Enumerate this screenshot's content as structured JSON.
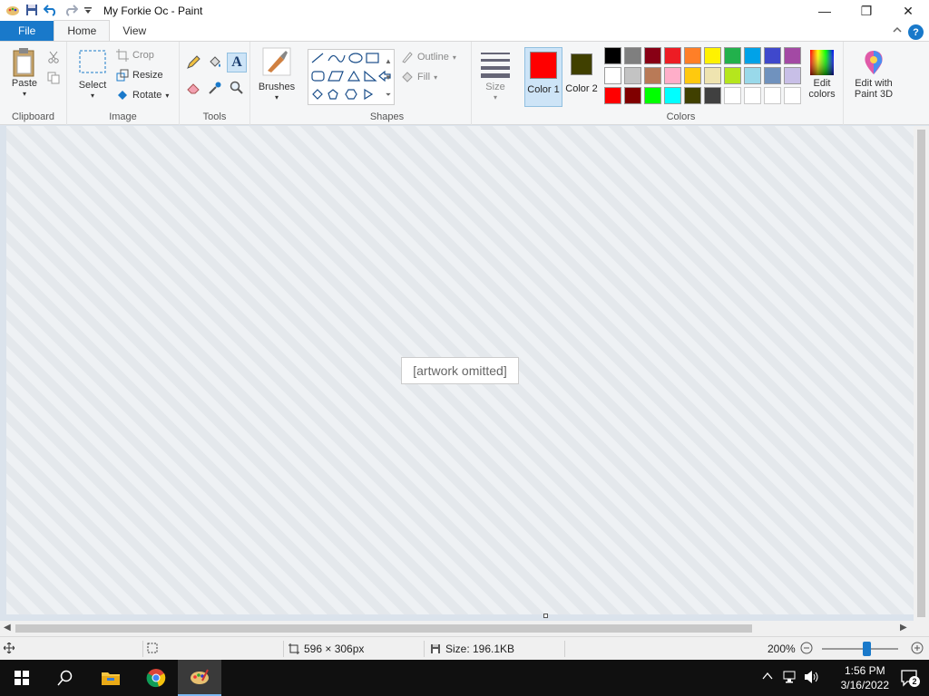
{
  "window": {
    "title": "My Forkie Oc - Paint",
    "controls": [
      "—",
      "❐",
      "✕"
    ]
  },
  "tabs": [
    "File",
    "Home",
    "View"
  ],
  "ribbon": {
    "clipboard": {
      "paste": "Paste",
      "label": "Clipboard"
    },
    "image": {
      "select": "Select",
      "crop": "Crop",
      "resize": "Resize",
      "rotate": "Rotate",
      "label": "Image"
    },
    "tools": {
      "label": "Tools"
    },
    "brushes": {
      "label": "Brushes"
    },
    "shapes": {
      "outline": "Outline",
      "fill": "Fill",
      "label": "Shapes"
    },
    "size": {
      "label": "Size"
    },
    "colors": {
      "color1": "Color 1",
      "color2": "Color 2",
      "color1_value": "#ff0000",
      "color2_value": "#404000",
      "edit_colors": "Edit colors",
      "label": "Colors",
      "palette_row1": [
        "#000000",
        "#7f7f7f",
        "#880015",
        "#ed1c24",
        "#ff7f27",
        "#fff200",
        "#22b14c",
        "#00a2e8",
        "#3f48cc",
        "#a349a4"
      ],
      "palette_row2": [
        "#ffffff",
        "#c3c3c3",
        "#b97a57",
        "#ffaec9",
        "#ffc90e",
        "#efe4b0",
        "#b5e61d",
        "#99d9ea",
        "#7092be",
        "#c8bfe7"
      ],
      "palette_row3": [
        "#ff0000",
        "#800000",
        "#00ff00",
        "#00ffff",
        "#404000",
        "#404040",
        "",
        "",
        "",
        ""
      ]
    },
    "paint3d": "Edit with Paint 3D"
  },
  "canvas": {
    "note": "[artwork omitted]"
  },
  "status": {
    "dimensions": "596 × 306px",
    "size": "Size: 196.1KB",
    "zoom": "200%"
  },
  "taskbar": {
    "time": "1:56 PM",
    "date": "3/16/2022",
    "notifications": "2"
  }
}
